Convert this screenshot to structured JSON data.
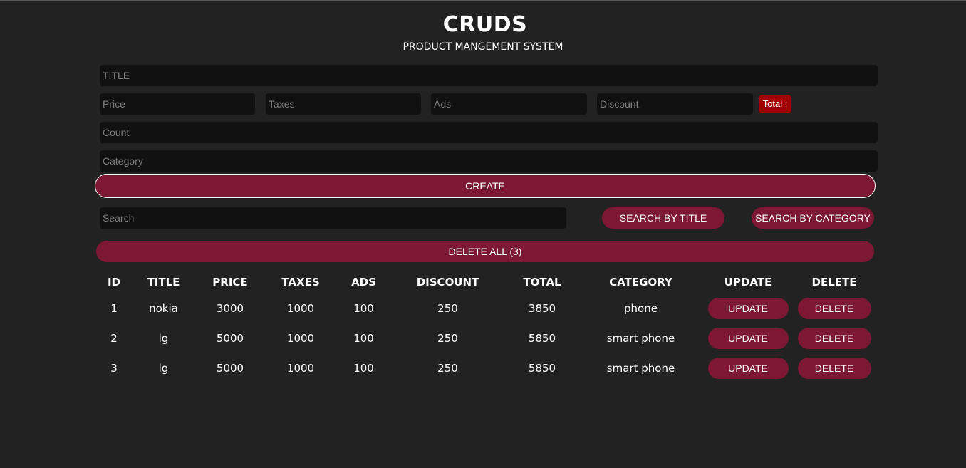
{
  "header": {
    "title": "CRUDS",
    "subtitle": "PRODUCT MANGEMENT SYSTEM"
  },
  "form": {
    "title_placeholder": "TITLE",
    "price_placeholder": "Price",
    "taxes_placeholder": "Taxes",
    "ads_placeholder": "Ads",
    "discount_placeholder": "Discount",
    "total_label": "Total :",
    "count_placeholder": "Count",
    "category_placeholder": "Category",
    "create_label": "CREATE"
  },
  "search": {
    "placeholder": "Search",
    "by_title_label": "SEARCH BY TITLE",
    "by_category_label": "SEARCH BY CATEGORY"
  },
  "delete_all_label": "DELETE ALL (3)",
  "colors": {
    "background": "#222222",
    "accent": "#7c1833",
    "total_badge": "#a00000",
    "input_bg": "#111111"
  },
  "table": {
    "headers": [
      "ID",
      "TITLE",
      "PRICE",
      "TAXES",
      "ADS",
      "DISCOUNT",
      "TOTAL",
      "CATEGORY",
      "UPDATE",
      "DELETE"
    ],
    "update_label": "UPDATE",
    "delete_label": "DELETE",
    "rows": [
      {
        "id": "1",
        "title": "nokia",
        "price": "3000",
        "taxes": "1000",
        "ads": "100",
        "discount": "250",
        "total": "3850",
        "category": "phone"
      },
      {
        "id": "2",
        "title": "lg",
        "price": "5000",
        "taxes": "1000",
        "ads": "100",
        "discount": "250",
        "total": "5850",
        "category": "smart phone"
      },
      {
        "id": "3",
        "title": "lg",
        "price": "5000",
        "taxes": "1000",
        "ads": "100",
        "discount": "250",
        "total": "5850",
        "category": "smart phone"
      }
    ]
  }
}
